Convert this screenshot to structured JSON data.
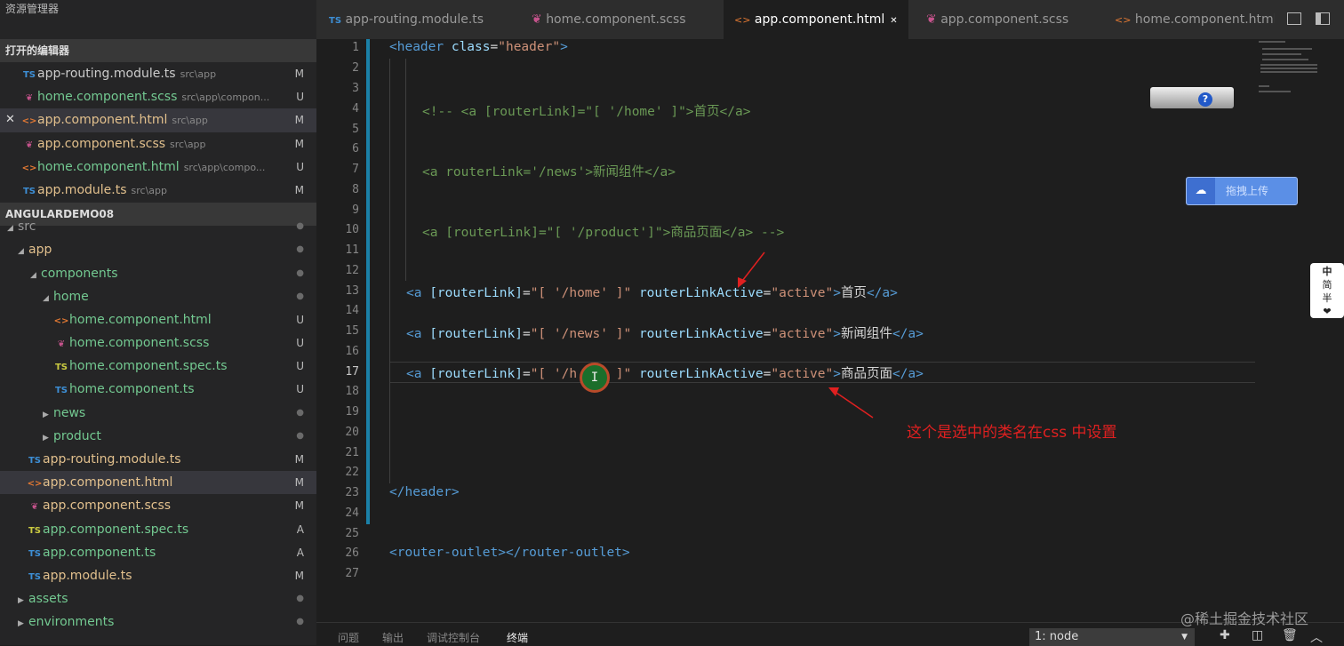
{
  "sidebar": {
    "title": "资源管理器",
    "open_editors_label": "打开的编辑器",
    "open_editors": [
      {
        "icon": "TS",
        "name": "app-routing.module.ts",
        "path": "src\\app",
        "status": "M"
      },
      {
        "icon": "scss",
        "name": "home.component.scss",
        "path": "src\\app\\compon...",
        "status": "U"
      },
      {
        "icon": "html",
        "name": "app.component.html",
        "path": "src\\app",
        "status": "M"
      },
      {
        "icon": "scss",
        "name": "app.component.scss",
        "path": "src\\app",
        "status": "M"
      },
      {
        "icon": "html",
        "name": "home.component.html",
        "path": "src\\app\\compo...",
        "status": "U"
      },
      {
        "icon": "TS",
        "name": "app.module.ts",
        "path": "src\\app",
        "status": "M"
      }
    ],
    "project_label": "ANGULARDEMO08",
    "tree": [
      {
        "label": "src",
        "status": "●"
      },
      {
        "label": "app",
        "status": "●"
      },
      {
        "label": "components",
        "status": "●"
      },
      {
        "label": "home",
        "status": "●"
      },
      {
        "label": "home.component.html",
        "status": "U"
      },
      {
        "label": "home.component.scss",
        "status": "U"
      },
      {
        "label": "home.component.spec.ts",
        "status": "U"
      },
      {
        "label": "home.component.ts",
        "status": "U"
      },
      {
        "label": "news",
        "status": "●"
      },
      {
        "label": "product",
        "status": "●"
      },
      {
        "label": "app-routing.module.ts",
        "status": "M"
      },
      {
        "label": "app.component.html",
        "status": "M"
      },
      {
        "label": "app.component.scss",
        "status": "M"
      },
      {
        "label": "app.component.spec.ts",
        "status": "A"
      },
      {
        "label": "app.component.ts",
        "status": "A"
      },
      {
        "label": "app.module.ts",
        "status": "M"
      },
      {
        "label": "assets",
        "status": "●"
      },
      {
        "label": "environments",
        "status": "●"
      }
    ]
  },
  "tabs": [
    {
      "label": "app-routing.module.ts"
    },
    {
      "label": "home.component.scss"
    },
    {
      "label": "app.component.html",
      "close": "✕"
    },
    {
      "label": "app.component.scss"
    },
    {
      "label": "home.component.html"
    }
  ],
  "editor": {
    "line_numbers": [
      "1",
      "2",
      "3",
      "4",
      "5",
      "6",
      "7",
      "8",
      "9",
      "10",
      "11",
      "12",
      "13",
      "14",
      "15",
      "16",
      "17",
      "18",
      "19",
      "20",
      "21",
      "22",
      "23",
      "24",
      "25",
      "26",
      "27"
    ],
    "code": {
      "l1_open": "<header",
      "l1_attr": "class",
      "l1_eq": "=",
      "l1_str": "\"header\"",
      "l1_close": ">",
      "l4": "<!-- <a [routerLink]=\"[ '/home' ]\">首页</a>",
      "l7": "<a routerLink='/news'>新闻组件</a>",
      "l10": "<a [routerLink]=\"[ '/product']\">商品页面</a> -->",
      "link_open": "<a",
      "attr_router": "[routerLink]",
      "eq": "=",
      "str_home": "\"[ '/home' ]\"",
      "str_news": "\"[ '/news' ]\"",
      "str_hm": "\"[ '/h",
      "str_hm_end": "' ]\"",
      "attr_active": "routerLinkActive",
      "str_active": "\"active\"",
      "gt": ">",
      "text_home": "首页",
      "text_news": "新闻组件",
      "text_product": "商品页面",
      "link_close": "</a>",
      "l23": "</header>",
      "l26_open": "<router-outlet>",
      "l26_close": "</router-outlet>"
    },
    "annotation": "这个是选中的类名在css 中设置",
    "upload_label": "拖拽上传",
    "ime": [
      "中",
      "简",
      "半",
      "❤"
    ],
    "help_char": "?"
  },
  "panel": {
    "tabs": [
      "问题",
      "输出",
      "调试控制台",
      "终端"
    ],
    "terminal_select": "1: node"
  },
  "watermark": "@稀土掘金技术社区"
}
